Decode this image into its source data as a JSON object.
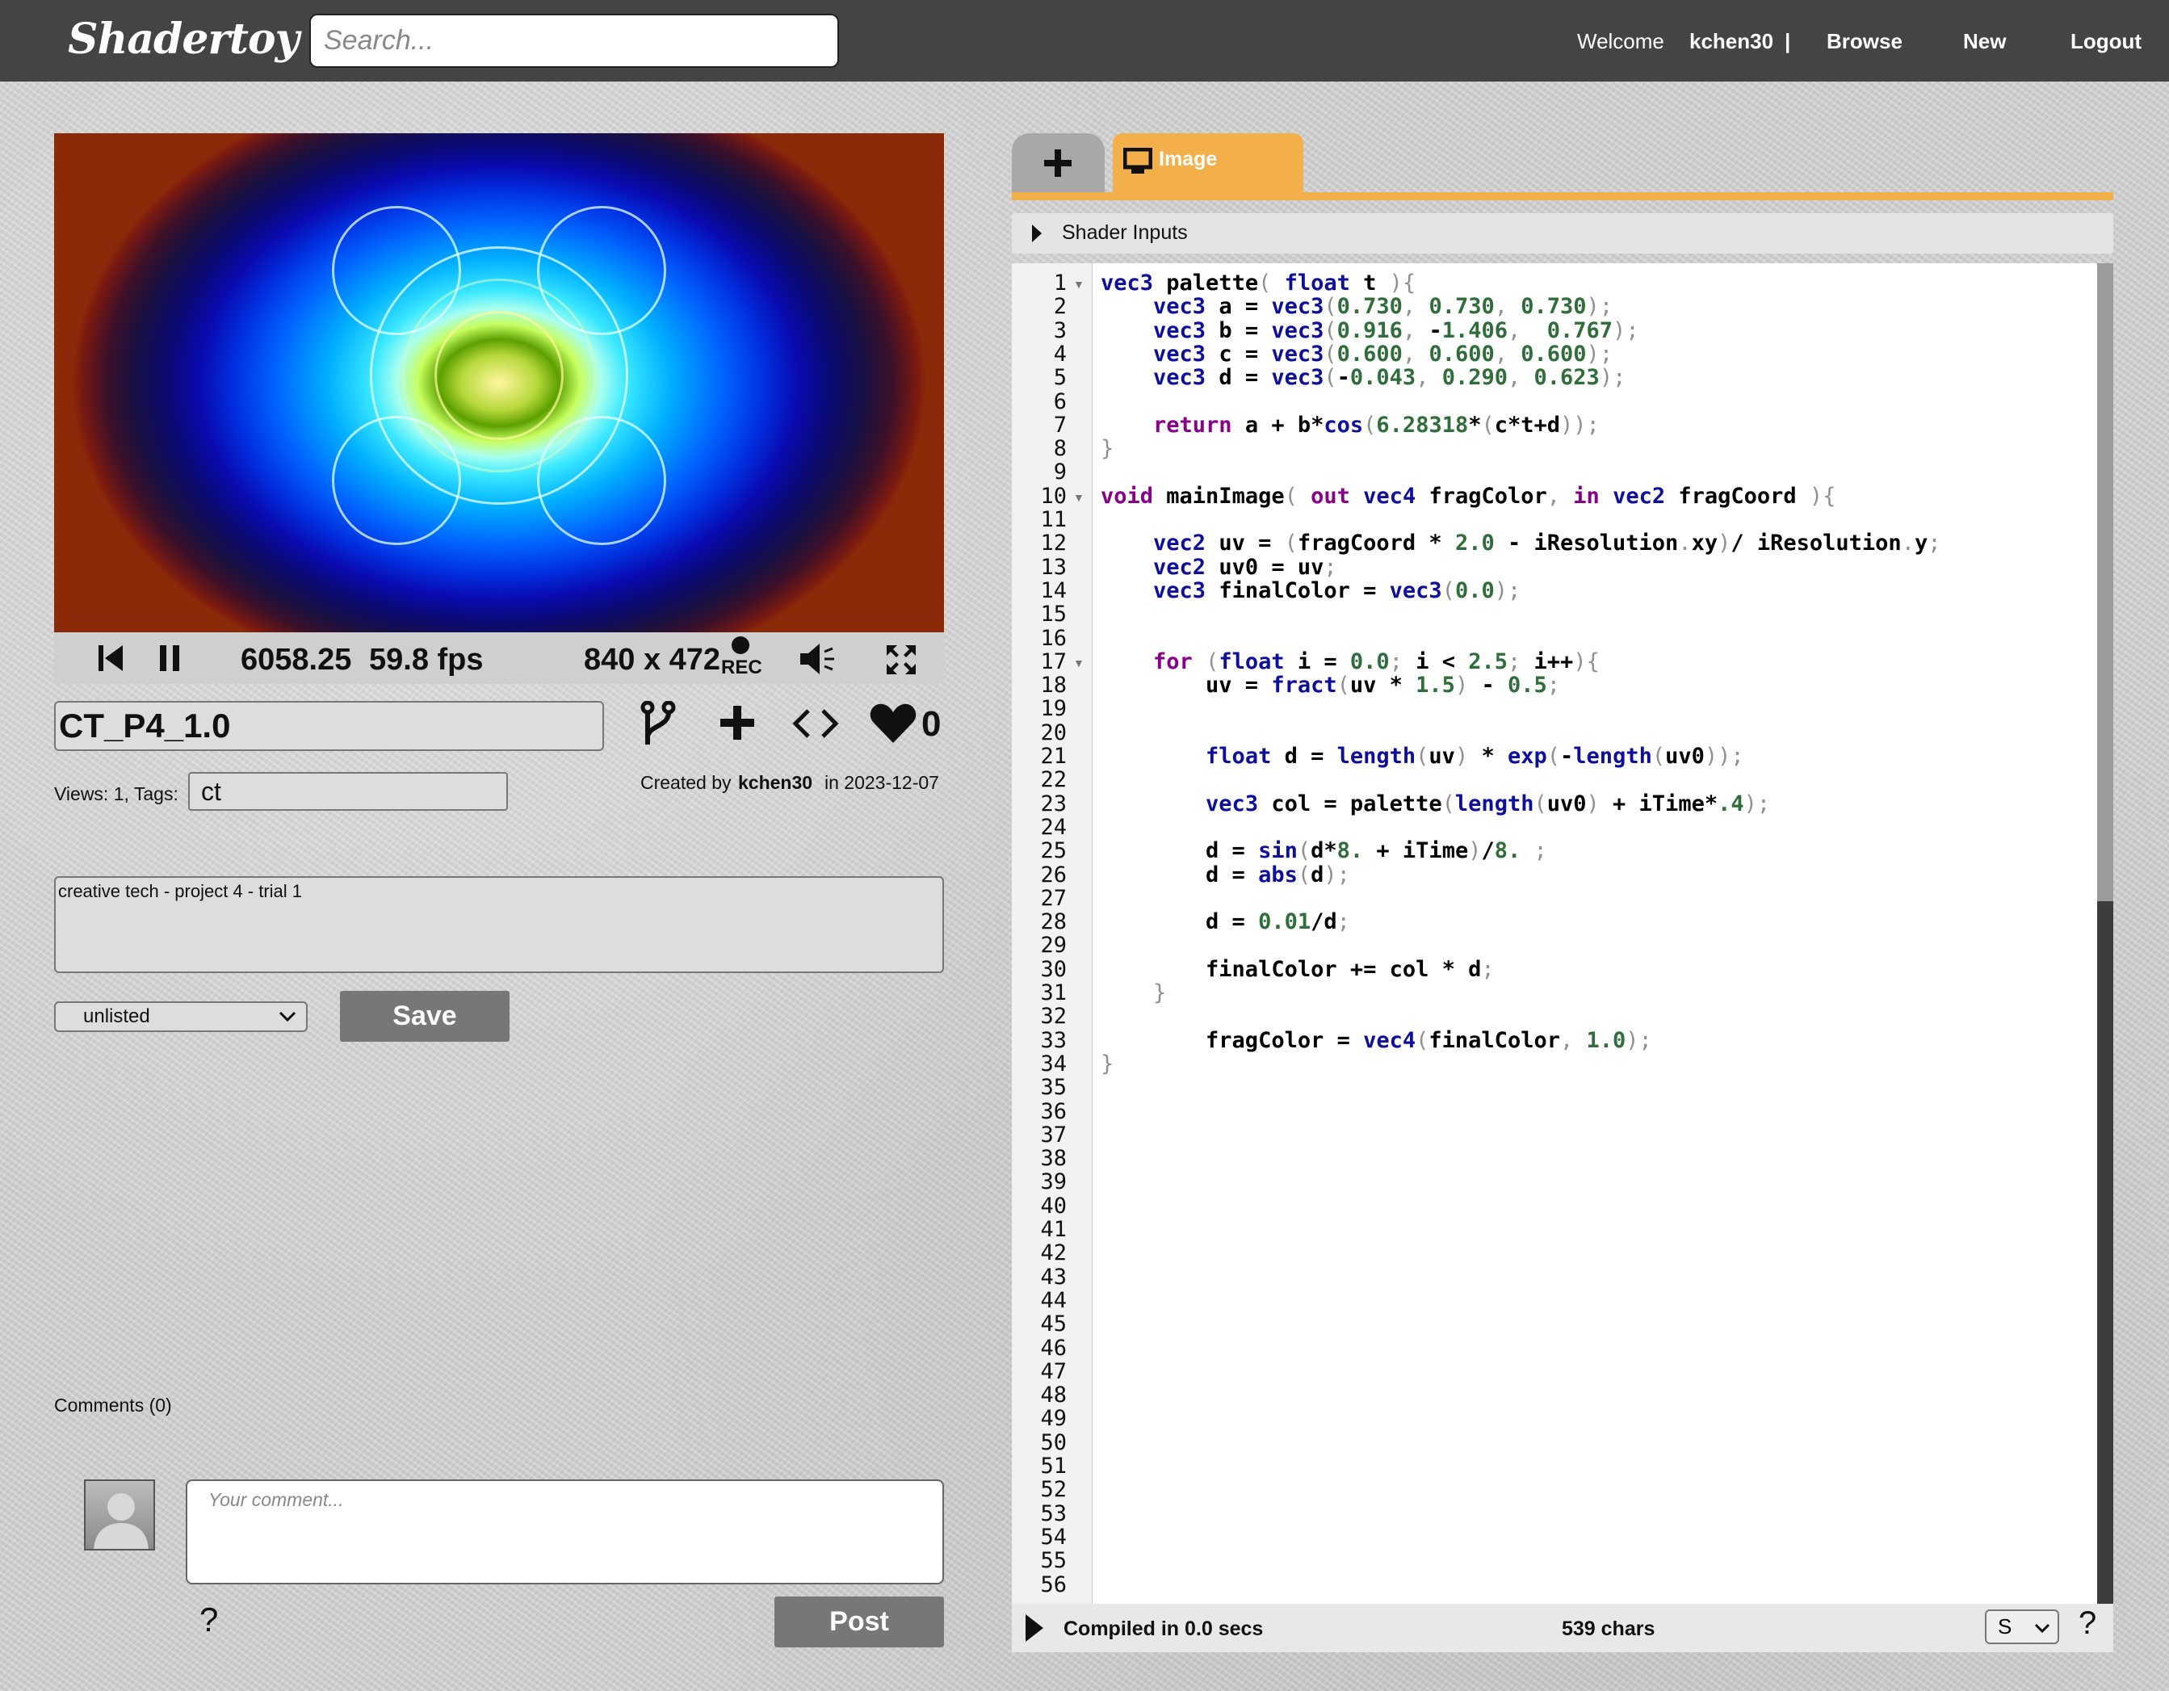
{
  "header": {
    "logo": "Shadertoy",
    "search_placeholder": "Search...",
    "welcome": "Welcome",
    "username": "kchen30",
    "separator": "|",
    "browse": "Browse",
    "new": "New",
    "logout": "Logout"
  },
  "player": {
    "time": "6058.25",
    "fps": "59.8 fps",
    "resolution": "840 x 472",
    "rec_label": "REC",
    "likes": "0"
  },
  "shader": {
    "name": "CT_P4_1.0",
    "views_tags_label": "Views: 1, Tags:",
    "tags": "ct",
    "created_by_label": "Created by",
    "author": "kchen30",
    "created_in": "in 2023-12-07",
    "description": "creative tech - project 4 - trial 1",
    "visibility": "unlisted",
    "save_label": "Save"
  },
  "comments": {
    "header": "Comments (0)",
    "placeholder": "Your comment...",
    "help": "?",
    "post_label": "Post"
  },
  "editor": {
    "tab_add": "+",
    "tab_image": "Image",
    "shader_inputs_label": "Shader Inputs",
    "code_lines": [
      "vec3 palette( float t ){",
      "    vec3 a = vec3(0.730, 0.730, 0.730);",
      "    vec3 b = vec3(0.916, -1.406,  0.767);",
      "    vec3 c = vec3(0.600, 0.600, 0.600);",
      "    vec3 d = vec3(-0.043, 0.290, 0.623);",
      "",
      "    return a + b*cos(6.28318*(c*t+d));",
      "}",
      "",
      "void mainImage( out vec4 fragColor, in vec2 fragCoord ){",
      "",
      "    vec2 uv = (fragCoord * 2.0 - iResolution.xy)/ iResolution.y;",
      "    vec2 uv0 = uv;",
      "    vec3 finalColor = vec3(0.0);",
      "",
      "",
      "    for (float i = 0.0; i < 2.5; i++){",
      "        uv = fract(uv * 1.5) - 0.5;",
      "",
      "",
      "        float d = length(uv) * exp(-length(uv0));",
      "",
      "        vec3 col = palette(length(uv0) + iTime*.4);",
      "",
      "        d = sin(d*8. + iTime)/8. ;",
      "        d = abs(d);",
      "",
      "        d = 0.01/d;",
      "",
      "        finalColor += col * d;",
      "    }",
      "",
      "        fragColor = vec4(finalColor, 1.0);",
      "}"
    ],
    "line_count": 56,
    "fold_lines": [
      1,
      10,
      17
    ],
    "compiled_status": "Compiled in 0.0 secs",
    "char_count": "539 chars",
    "font_size_option": "S",
    "help": "?"
  }
}
